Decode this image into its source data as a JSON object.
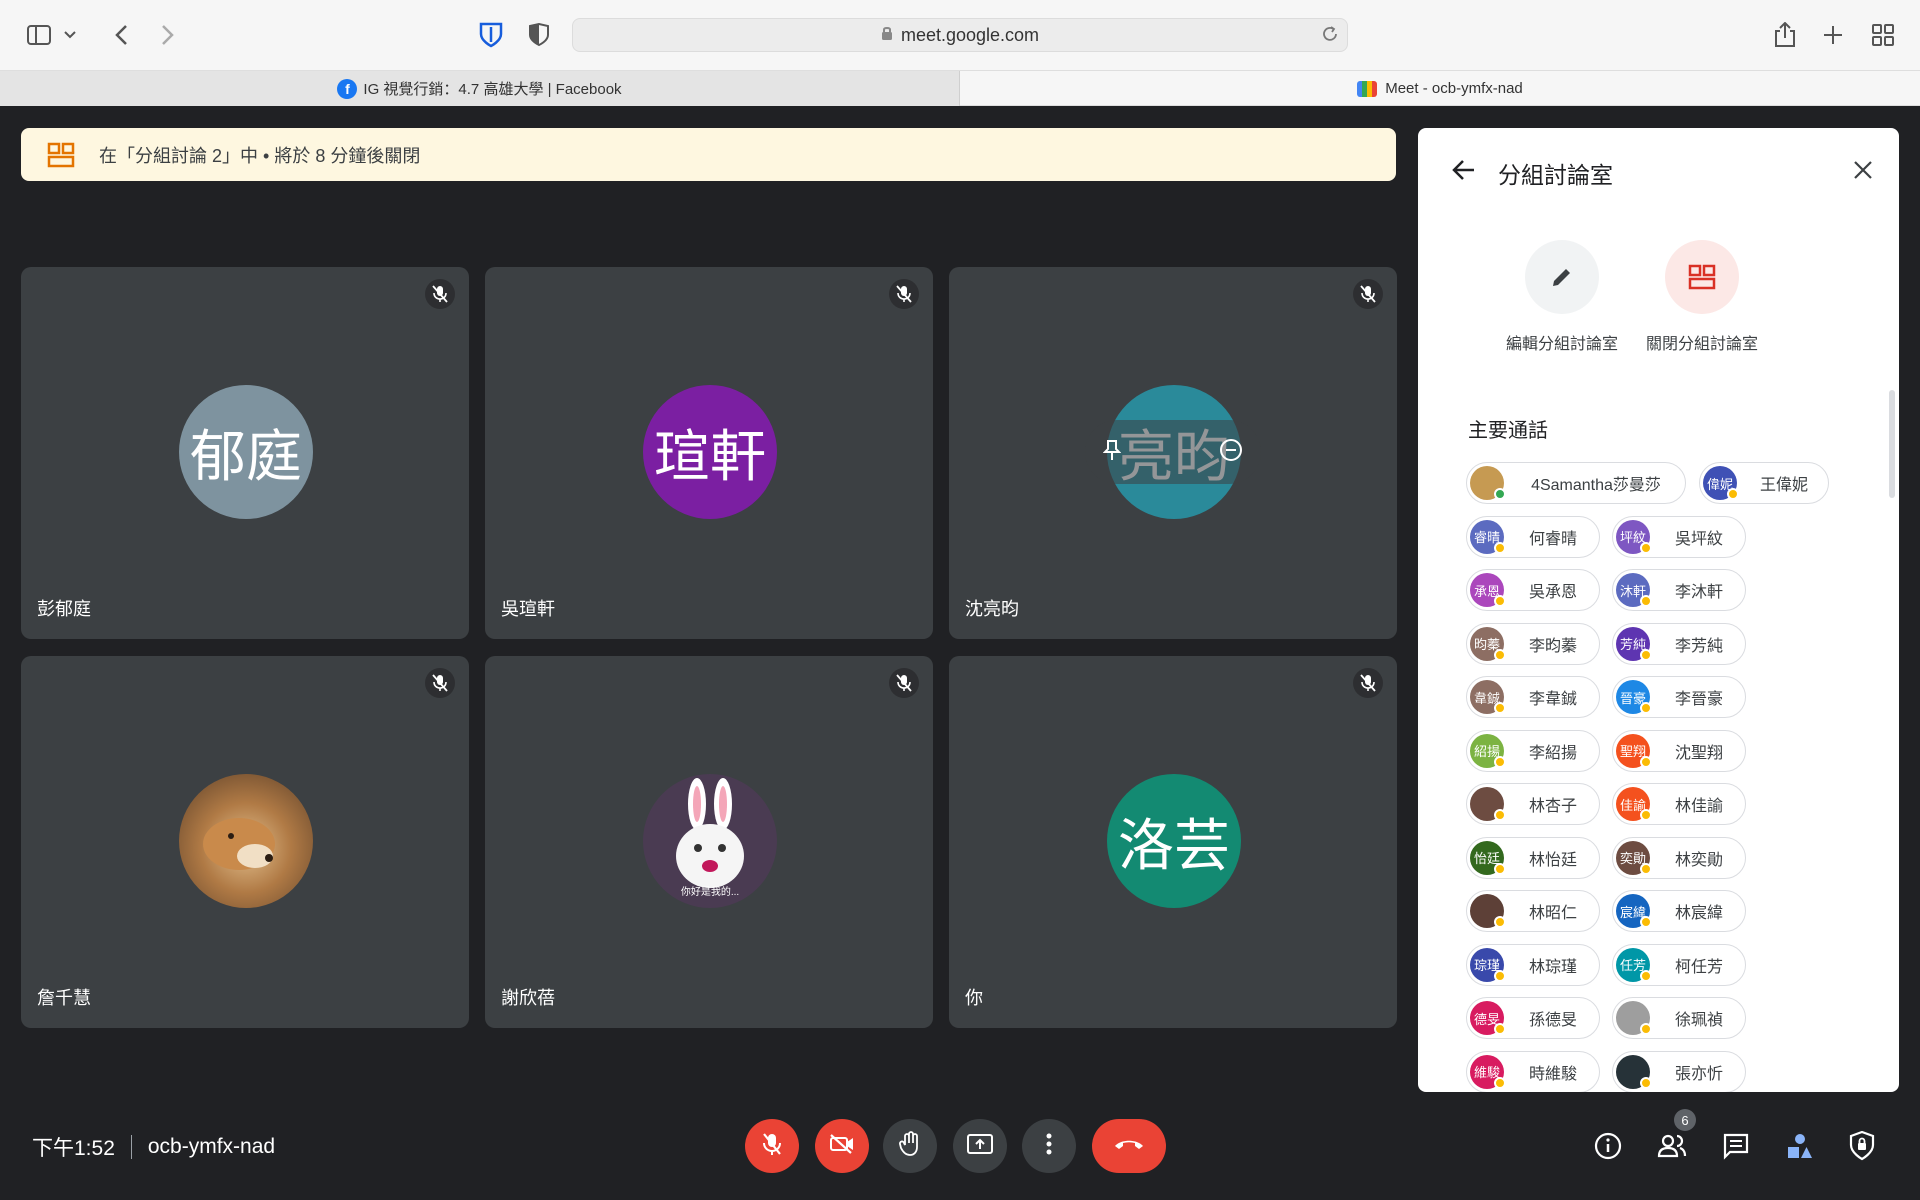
{
  "browser": {
    "url": "meet.google.com",
    "tabs": [
      {
        "label": "IG 視覺行銷：4.7 高雄大學 | Facebook",
        "icon": "facebook-icon"
      },
      {
        "label": "Meet - ocb-ymfx-nad",
        "icon": "meet-icon"
      }
    ]
  },
  "banner": {
    "text": "在「分組討論 2」中 • 將於 8 分鐘後關閉"
  },
  "tiles": [
    {
      "name": "彭郁庭",
      "avatar_text": "郁庭",
      "avatar_color": "#7e939f"
    },
    {
      "name": "吳瑄軒",
      "avatar_text": "瑄軒",
      "avatar_color": "#7b1fa2"
    },
    {
      "name": "沈亮昀",
      "avatar_text": "亮昀",
      "avatar_color": "#2a8a9a"
    },
    {
      "name": "詹千慧",
      "avatar_text": "",
      "avatar_color": "#a67c52",
      "avatar_icon": "fox-photo"
    },
    {
      "name": "謝欣蓓",
      "avatar_text": "",
      "avatar_color": "#4a3b52",
      "avatar_icon": "rabbit-photo",
      "photo_caption": "你好是我的..."
    },
    {
      "name": "你",
      "avatar_text": "洛芸",
      "avatar_color": "#138a72"
    }
  ],
  "panel": {
    "title": "分組討論室",
    "edit_label": "編輯分組討論室",
    "close_label": "關閉分組討論室",
    "section_title": "主要通話",
    "participants": [
      {
        "name": "4Samantha莎曼莎",
        "avatar_text": "",
        "color": "#c69a52",
        "status": "#34a853"
      },
      {
        "name": "王偉妮",
        "avatar_text": "偉妮",
        "color": "#3f51b5",
        "status": "#fbbc04"
      },
      {
        "name": "何睿晴",
        "avatar_text": "睿晴",
        "color": "#5c6bc0",
        "status": "#fbbc04"
      },
      {
        "name": "吳坪紋",
        "avatar_text": "坪紋",
        "color": "#7e57c2",
        "status": "#fbbc04"
      },
      {
        "name": "吳承恩",
        "avatar_text": "承恩",
        "color": "#ab47bc",
        "status": "#fbbc04"
      },
      {
        "name": "李沐軒",
        "avatar_text": "沐軒",
        "color": "#5c6bc0",
        "status": "#fbbc04"
      },
      {
        "name": "李昀蓁",
        "avatar_text": "昀蓁",
        "color": "#8d6e63",
        "status": "#fbbc04"
      },
      {
        "name": "李芳純",
        "avatar_text": "芳純",
        "color": "#5e35b1",
        "status": "#fbbc04"
      },
      {
        "name": "李韋鋮",
        "avatar_text": "韋鋮",
        "color": "#8d6e63",
        "status": "#fbbc04"
      },
      {
        "name": "李晉豪",
        "avatar_text": "晉豪",
        "color": "#1e88e5",
        "status": "#fbbc04"
      },
      {
        "name": "李紹揚",
        "avatar_text": "紹揚",
        "color": "#7cb342",
        "status": "#fbbc04"
      },
      {
        "name": "沈聖翔",
        "avatar_text": "聖翔",
        "color": "#f4511e",
        "status": "#fbbc04"
      },
      {
        "name": "林杏子",
        "avatar_text": "",
        "color": "#6d4c41",
        "status": "#fbbc04"
      },
      {
        "name": "林佳諭",
        "avatar_text": "佳諭",
        "color": "#f4511e",
        "status": "#fbbc04"
      },
      {
        "name": "林怡廷",
        "avatar_text": "怡廷",
        "color": "#33691e",
        "status": "#fbbc04"
      },
      {
        "name": "林奕勛",
        "avatar_text": "奕勛",
        "color": "#6d4c41",
        "status": "#fbbc04"
      },
      {
        "name": "林昭仁",
        "avatar_text": "",
        "color": "#5d4037",
        "status": "#fbbc04"
      },
      {
        "name": "林宸緯",
        "avatar_text": "宸緯",
        "color": "#1565c0",
        "status": "#fbbc04"
      },
      {
        "name": "林琮瑾",
        "avatar_text": "琮瑾",
        "color": "#3949ab",
        "status": "#fbbc04"
      },
      {
        "name": "柯任芳",
        "avatar_text": "任芳",
        "color": "#0097a7",
        "status": "#fbbc04"
      },
      {
        "name": "孫德旻",
        "avatar_text": "德旻",
        "color": "#d81b60",
        "status": "#fbbc04"
      },
      {
        "name": "徐珮禎",
        "avatar_text": "",
        "color": "#9e9e9e",
        "status": "#fbbc04"
      },
      {
        "name": "時維駿",
        "avatar_text": "維駿",
        "color": "#d81b60",
        "status": "#fbbc04"
      },
      {
        "name": "張亦忻",
        "avatar_text": "",
        "color": "#263238",
        "status": "#fbbc04"
      }
    ]
  },
  "bottom": {
    "time": "下午1:52",
    "meeting_code": "ocb-ymfx-nad",
    "people_count": "6"
  },
  "colors": {
    "danger": "#ea4335",
    "banner_bg": "#fef7e0",
    "tile_bg": "#3c4043",
    "bg": "#202124"
  }
}
